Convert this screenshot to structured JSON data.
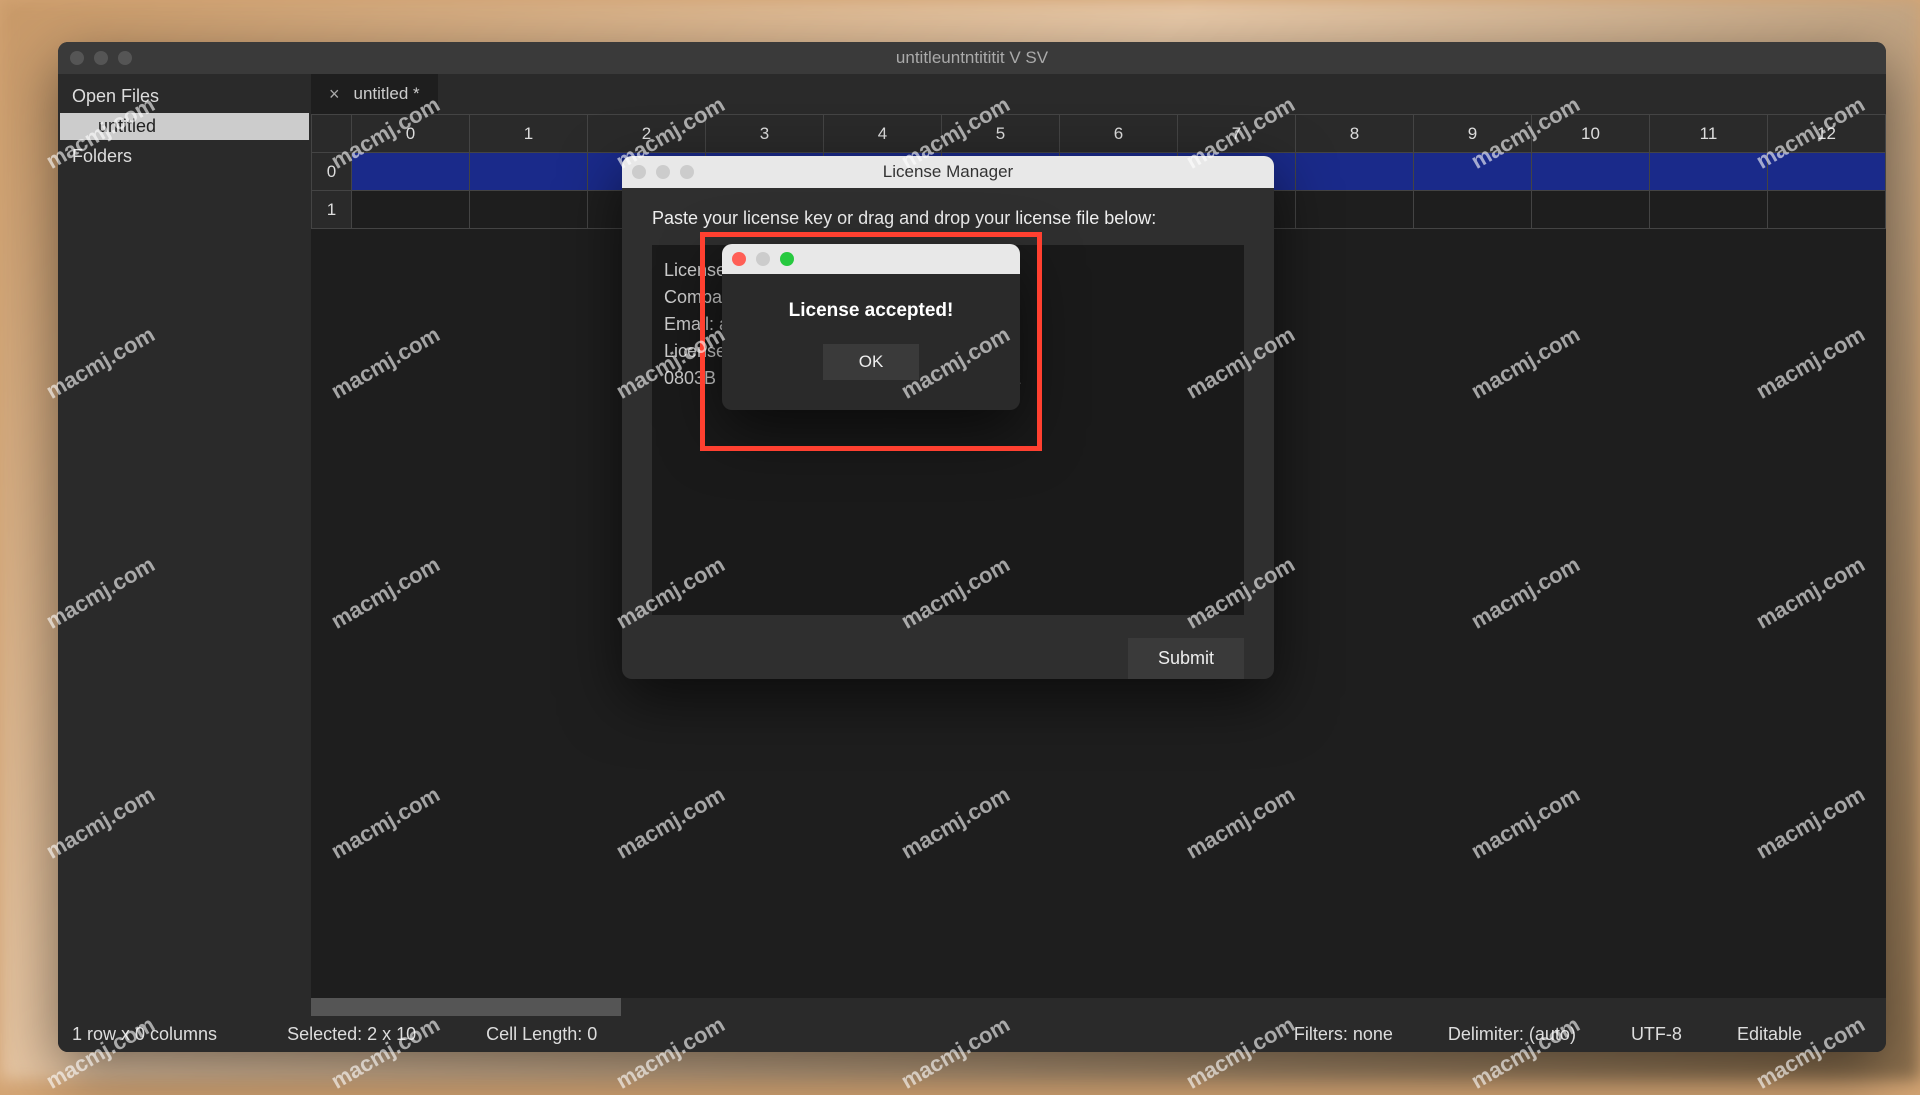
{
  "window": {
    "title": "untitleuntntititit  V  SV"
  },
  "sidebar": {
    "open_files_label": "Open Files",
    "file1": "untitled",
    "folders_label": "Folders"
  },
  "tab": {
    "name": "untitled *",
    "close": "×"
  },
  "grid": {
    "cols": [
      "0",
      "1",
      "2",
      "3",
      "4",
      "5",
      "6",
      "7",
      "8",
      "9",
      "10",
      "11",
      "12"
    ],
    "rows": [
      "0",
      "1"
    ]
  },
  "license_modal": {
    "title": "License Manager",
    "instruction": "Paste your license key or drag and drop your license file below:",
    "text": "License\nCompa\nEmail: a\nLicense\n0803B                                                     1812",
    "submit": "Submit"
  },
  "alert": {
    "message": "License accepted!",
    "ok": "OK"
  },
  "statusbar": {
    "rows": "1 row x 0 columns",
    "selected": "Selected: 2 x 10",
    "cell": "Cell Length: 0",
    "filters": "Filters: none",
    "delimiter": "Delimiter: (auto)",
    "encoding": "UTF-8",
    "mode": "Editable"
  },
  "watermark": "macmj.com"
}
